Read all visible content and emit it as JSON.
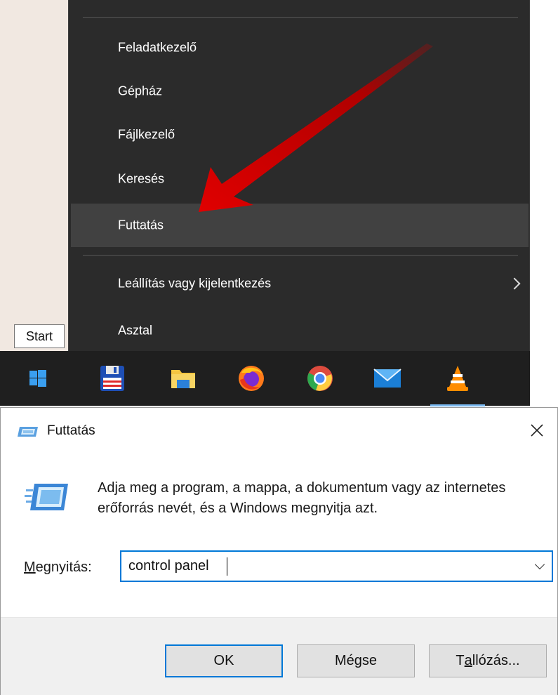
{
  "context_menu": {
    "items": [
      {
        "label": "Feladatkezelő"
      },
      {
        "label": "Gépház"
      },
      {
        "label": "Fájlkezelő"
      },
      {
        "label": "Keresés"
      },
      {
        "label": "Futtatás",
        "highlighted": true
      },
      {
        "label": "Leállítás vagy kijelentkezés",
        "has_submenu": true
      },
      {
        "label": "Asztal"
      }
    ]
  },
  "tooltip": {
    "text": "Start"
  },
  "taskbar": {
    "icons": [
      "windows-start-icon",
      "floppy-save-icon",
      "file-explorer-icon",
      "firefox-icon",
      "chrome-icon",
      "mail-icon",
      "vlc-icon"
    ],
    "accent": "#7ab8f0"
  },
  "run_dialog": {
    "title": "Futtatás",
    "description": "Adja meg a program, a mappa, a dokumentum vagy az internetes erőforrás nevét, és a Windows megnyitja azt.",
    "open_label_underlined": "M",
    "open_label_rest": "egnyitás:",
    "input_value": "control panel",
    "buttons": {
      "ok": "OK",
      "cancel": "Mégse",
      "browse_pre": "T",
      "browse_underlined": "a",
      "browse_post": "llózás..."
    }
  },
  "colors": {
    "menu_bg": "#2b2b2b",
    "menu_highlight": "#414141",
    "focus_blue": "#0078d7",
    "arrow_red": "#d40000"
  }
}
